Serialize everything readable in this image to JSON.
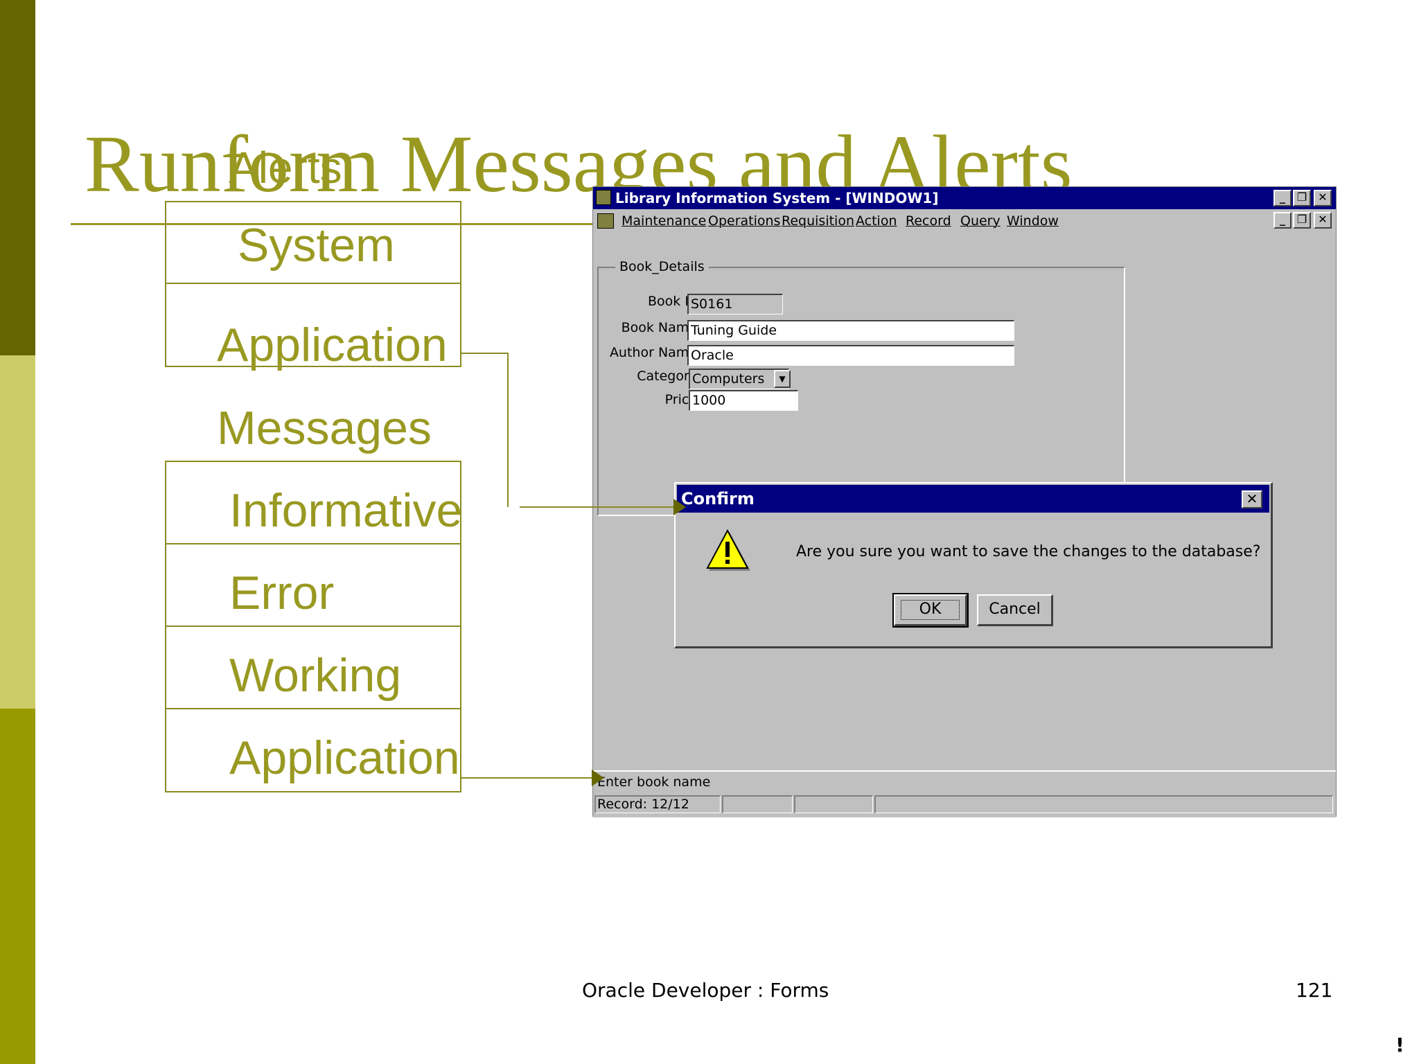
{
  "slide": {
    "title": "Runform Messages and Alerts",
    "overlay_title": "Alerts",
    "footer": "Oracle Developer : Forms",
    "page_number": "121",
    "corner_mark": "!",
    "alerts_boxes": [
      "System",
      "Application"
    ],
    "messages_heading": "Messages",
    "message_boxes": [
      "Informative",
      "Error",
      "Working",
      "Application"
    ],
    "colors": {
      "olive_dark": "#666600",
      "olive_light": "#cccc66",
      "olive_mid": "#999900",
      "text_olive": "#999922"
    }
  },
  "app": {
    "window_title": "Library Information System - [WINDOW1]",
    "menu": [
      "Maintenance",
      "Operations",
      "Requisition",
      "Action",
      "Record",
      "Query",
      "Window"
    ],
    "frame_label": "Book_Details",
    "fields": {
      "book_id": {
        "label": "Book Id",
        "value": "S0161"
      },
      "book_name": {
        "label": "Book Name",
        "value": "Tuning Guide"
      },
      "author_name": {
        "label": "Author Name",
        "value": "Oracle"
      },
      "category": {
        "label": "Category",
        "value": "Computers"
      },
      "price": {
        "label": "Price",
        "value": "1000"
      }
    },
    "status": {
      "message": "Enter book name",
      "record": "Record: 12/12"
    },
    "icons": {
      "app_icon": "oracle-forms-icon",
      "minimize": "minimize-icon",
      "restore": "restore-icon",
      "close": "close-icon"
    }
  },
  "dialog": {
    "title": "Confirm",
    "message": "Are you sure you want to save the changes to the database?",
    "ok_label": "OK",
    "cancel_label": "Cancel",
    "icon": "warning-icon"
  }
}
